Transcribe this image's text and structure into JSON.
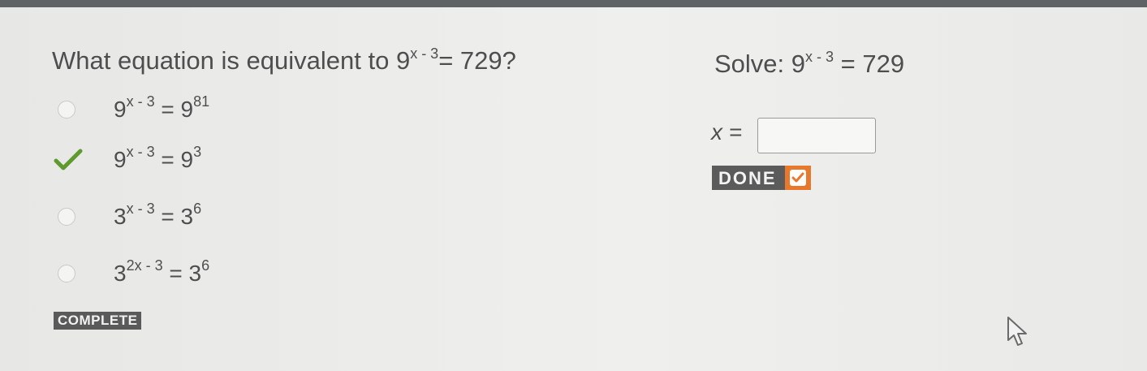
{
  "question": {
    "prefix": "What equation is equivalent to ",
    "base": "9",
    "exponent": "x - 3",
    "rhs": "= 729?"
  },
  "options": [
    {
      "base": "9",
      "exponent": "x - 3",
      "eq": "=",
      "rhs_base": "9",
      "rhs_exp": "81",
      "state": "unselected"
    },
    {
      "base": "9",
      "exponent": "x - 3",
      "eq": "=",
      "rhs_base": "9",
      "rhs_exp": "3",
      "state": "correct"
    },
    {
      "base": "3",
      "exponent": "x - 3",
      "eq": "=",
      "rhs_base": "3",
      "rhs_exp": "6",
      "state": "unselected"
    },
    {
      "base": "3",
      "exponent": "2x - 3",
      "eq": "=",
      "rhs_base": "3",
      "rhs_exp": "6",
      "state": "unselected"
    }
  ],
  "complete_badge": "COMPLETE",
  "solve": {
    "prefix": "Solve: ",
    "base": "9",
    "exponent": "x - 3",
    "rhs": "= 729"
  },
  "answer": {
    "label": "x =",
    "value": ""
  },
  "done_button": {
    "label": "DONE",
    "accent_color": "#e8782b"
  },
  "icons": {
    "correct": "checkmark-icon",
    "unselected": "radio-icon",
    "done": "check-icon",
    "pointer": "mouse-pointer-icon"
  }
}
